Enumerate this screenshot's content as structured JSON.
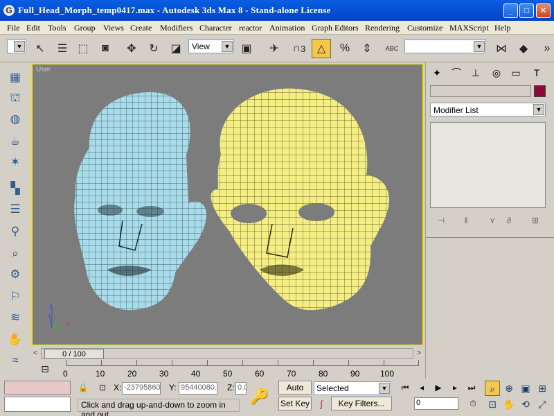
{
  "window": {
    "title": "Full_Head_Morph_temp0417.max - Autodesk 3ds Max 8  - Stand-alone License",
    "min": "_",
    "max": "□",
    "close": "✕"
  },
  "menu": [
    "File",
    "Edit",
    "Tools",
    "Group",
    "Views",
    "Create",
    "Modifiers",
    "Character",
    "reactor",
    "Animation",
    "Graph Editors",
    "Rendering",
    "Customize",
    "MAXScript",
    "Help"
  ],
  "toolbar": {
    "refcoord": "View",
    "superscript": "3",
    "named_selection": "",
    "abc_label": "ABC"
  },
  "viewport": {
    "label": "User",
    "axis_x": "x",
    "axis_y": "y",
    "axis_z": "z",
    "colors": {
      "left_head": "#a8dcea",
      "right_head": "#f4ee84",
      "border": "#f0e020",
      "background": "#7c7c7c"
    }
  },
  "timeslider": {
    "position": "0 / 100",
    "prev": "<",
    "next": ">"
  },
  "ruler": {
    "labels": [
      "0",
      "10",
      "20",
      "30",
      "40",
      "50",
      "60",
      "70",
      "80",
      "90",
      "100"
    ]
  },
  "command_panel": {
    "object_name": "",
    "modifier_list": "Modifier List",
    "object_color": "#8b0a3a"
  },
  "status": {
    "x_label": "X:",
    "x_value": "-23795860",
    "y_label": "Y:",
    "y_value": "95440080.",
    "z_label": "Z:",
    "z_value": "0.0",
    "prompt": "Click and drag up-and-down to zoom in and out",
    "auto_key": "Auto Key",
    "set_key": "Set Key",
    "key_mode": "Selected",
    "key_filters": "Key Filters...",
    "frame": "0"
  }
}
